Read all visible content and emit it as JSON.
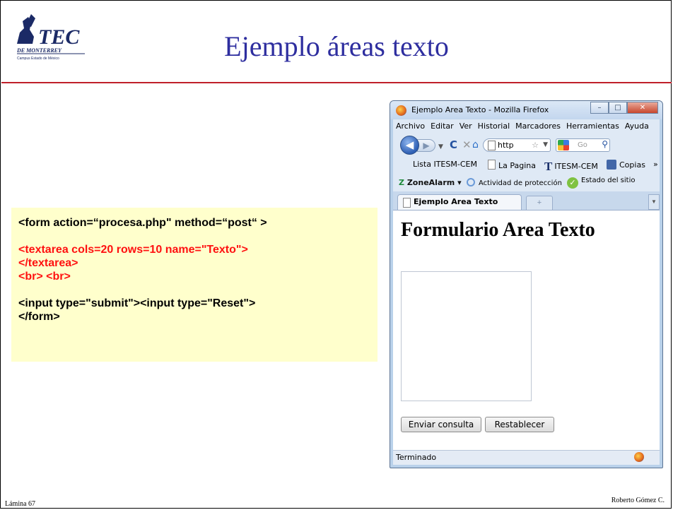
{
  "slide": {
    "title": "Ejemplo áreas texto",
    "footer_left": "Lámina 67",
    "footer_right": "Roberto Gómez C.",
    "logo": {
      "name": "tec-de-monterrey-logo",
      "text": "TEC DE MONTERREY",
      "subtext": "Campus Estado de México"
    },
    "accent_color": "#c0202a",
    "title_color": "#2e2e9f"
  },
  "code": {
    "line1": "<form  action=“procesa.php\"    method=“post“ >",
    "line2": "<textarea cols=20 rows=10 name=\"Texto\">",
    "line3": "</textarea>",
    "line4": "<br> <br>",
    "line5": "<input type=\"submit\"><input type=\"Reset\">",
    "line6": "</form>",
    "background": "#ffffcc",
    "highlight_color": "#ff1010"
  },
  "browser": {
    "window_title": "Ejemplo Area Texto - Mozilla Firefox",
    "menu": [
      "Archivo",
      "Editar",
      "Ver",
      "Historial",
      "Marcadores",
      "Herramientas",
      "Ayuda"
    ],
    "url_text": "http",
    "search_placeholder": "Go",
    "bookmarks": [
      "Lista ITESM-CEM",
      "La Pagina",
      "ITESM-CEM",
      "Copias"
    ],
    "bookmarks_more": "»",
    "zonealarm": {
      "label_prefix": "Z",
      "label": "ZoneAlarm",
      "activity": "Actividad de protección",
      "status": "Estado del sitio"
    },
    "tab_label": "Ejemplo Area Texto",
    "page_heading": "Formulario Area Texto",
    "submit_label": "Enviar consulta",
    "reset_label": "Restablecer",
    "status_text": "Terminado"
  }
}
